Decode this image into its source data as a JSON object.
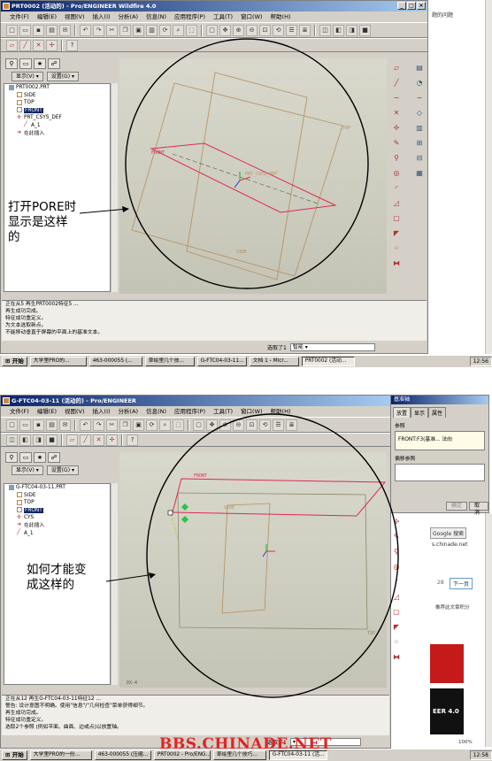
{
  "top": {
    "title": "PRT0002 (活动的) - Pro/ENGINEER Wildfire 4.0",
    "menu": [
      "文件(F)",
      "编辑(E)",
      "视图(V)",
      "插入(I)",
      "分析(A)",
      "信息(N)",
      "应用程序(P)",
      "工具(T)",
      "窗口(W)",
      "帮助(H)"
    ],
    "nav_buttons": [
      "显示(V) ▾",
      "设置(G) ▾"
    ],
    "tree": [
      "PRT0002.PRT",
      "SIDE",
      "TOP",
      "FRONT",
      "PRT_CSYS_DEF",
      "A_1",
      "在此插入"
    ],
    "graphics_labels": {
      "front": "FRONT",
      "csys": "PRT_CSYS_DEF",
      "side": "SIDE",
      "top": "TOP"
    },
    "messages": [
      "正在从5 再生PRT0002特征5 ...",
      "再生成功完成。",
      "特征成功重定义。",
      "为文本选取新点。",
      "不能移动垂直于屏幕的平面上的基准文本。"
    ],
    "status": {
      "pick": "选取了1",
      "filter": "智能"
    },
    "annotation": "打开PORE时\n显示是这样\n的",
    "side_text": "题的问题"
  },
  "bottom": {
    "title": "G-FTC04-03-11 (活动的) - Pro/ENGINEER",
    "menu": [
      "文件(F)",
      "编辑(E)",
      "视图(V)",
      "插入(I)",
      "分析(A)",
      "信息(N)",
      "应用程序(P)",
      "工具(T)",
      "窗口(W)",
      "帮助(H)"
    ],
    "nav_buttons": [
      "显示(V) ▾",
      "设置(G) ▾"
    ],
    "tree": [
      "G-FTC04-03-11.PRT",
      "SIDE",
      "TOP",
      "FRONT",
      "CYS",
      "在此插入",
      "A_1"
    ],
    "graphics_labels": {
      "front": "FRONT",
      "side": "SIDE",
      "top": "TOP",
      "axis": "DX-4"
    },
    "messages": [
      "正在从12 再生G-FTC04-03-11特征12 ...",
      "警告: 设计意图不明确。使用\"信息\"/\"几何检查\"菜单获得细节。",
      "再生成功完成。",
      "特征成功重定义。",
      "选取2个参照 (例如平面、曲面、边或点)以放置轴。"
    ],
    "status": {
      "pick": "选取了1"
    },
    "annotation": "如何才能变\n成这样的",
    "dialog": {
      "title": "基准轴",
      "tabs": [
        "放置",
        "显示",
        "属性"
      ],
      "ref_label": "参照",
      "ref_value": "FRONT:F3(基准... 法向",
      "offset_label": "偏移参照",
      "ok": "确定",
      "cancel": "取消"
    },
    "web": {
      "google": "Google 搜索",
      "site": "s.chinade.net",
      "page": "28",
      "next": "下一页",
      "recommend": "推荐此文章积分",
      "brand": "EER 4.0"
    }
  },
  "taskbar_top": {
    "start": "开始",
    "tasks": [
      "大学里PRO的...",
      "463-000055 (...",
      "草绘里几个技...",
      "G-FTC04-03-11...",
      "文档 1 - Micr...",
      "PRT0002 (活动..."
    ],
    "clock": "12:56"
  },
  "taskbar_bottom": {
    "start": "开始",
    "tasks": [
      "大学里PRO的一份...",
      "463-000055 (压缩...",
      "PRT0002 - Pro/ENG...",
      "草绘里几个技巧...",
      "G-FTC04-03-11 (活..."
    ],
    "clock": "12:58",
    "zoom": "100%"
  },
  "watermark": "BBS.CHINADE.NET"
}
